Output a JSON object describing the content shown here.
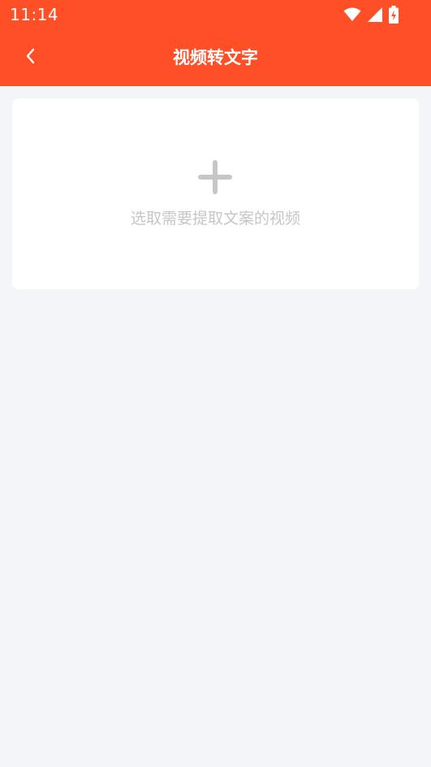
{
  "status_bar": {
    "time": "11:14",
    "icons": [
      "wifi-icon",
      "cellular-signal-icon",
      "battery-charging-icon"
    ]
  },
  "nav": {
    "back_icon": "chevron-left-icon",
    "title": "视频转文字"
  },
  "upload_card": {
    "icon": "plus-icon",
    "hint": "选取需要提取文案的视频"
  },
  "colors": {
    "header_background": "#ff4f27",
    "page_background": "#f4f5f9",
    "card_background": "#ffffff",
    "icon_gray": "#c6c6c8",
    "hint_text": "#c6c6c8"
  }
}
